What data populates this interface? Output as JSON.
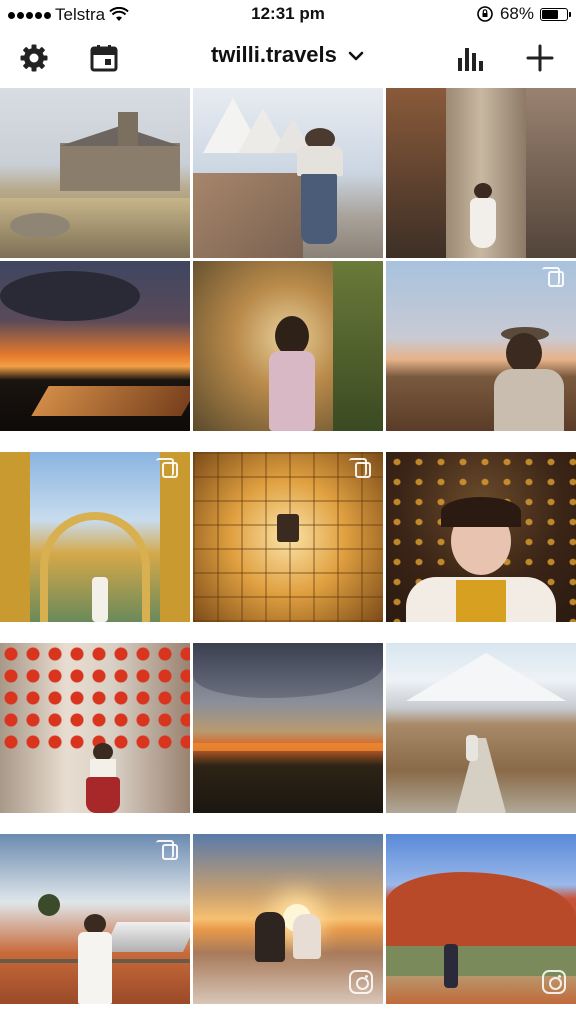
{
  "status_bar": {
    "carrier": "Telstra",
    "time": "12:31 pm",
    "battery_percent": "68%",
    "battery_level": 0.68
  },
  "nav": {
    "username": "twilli.travels",
    "icons": [
      "gear-icon",
      "calendar-icon",
      "chevron-down-icon",
      "bar-chart-icon",
      "plus-icon"
    ]
  },
  "grid": {
    "posts": [
      {
        "name": "post-church-lake-tekapo",
        "badge": "none"
      },
      {
        "name": "post-sydney-opera-house",
        "badge": "none"
      },
      {
        "name": "post-melbourne-laneway",
        "badge": "none"
      },
      {
        "name": "post-sunset-solar-farm",
        "badge": "none"
      },
      {
        "name": "post-fairy-light-garden",
        "badge": "none"
      },
      {
        "name": "post-desert-dusk-portrait",
        "badge": "multiple"
      },
      {
        "name": "post-moroccan-arch",
        "badge": "multiple"
      },
      {
        "name": "post-infinity-mirror-room",
        "badge": "multiple"
      },
      {
        "name": "post-autumn-leaves-portrait",
        "badge": "none"
      },
      {
        "name": "post-red-lanterns-alley",
        "badge": "none"
      },
      {
        "name": "post-stormy-outback-sky",
        "badge": "none"
      },
      {
        "name": "post-mountain-hiking-trail",
        "badge": "none"
      },
      {
        "name": "post-outback-white-jumpsuit",
        "badge": "multiple"
      },
      {
        "name": "post-sunrise-couple",
        "badge": "reel"
      },
      {
        "name": "post-uluru-walk",
        "badge": "reel"
      }
    ]
  }
}
